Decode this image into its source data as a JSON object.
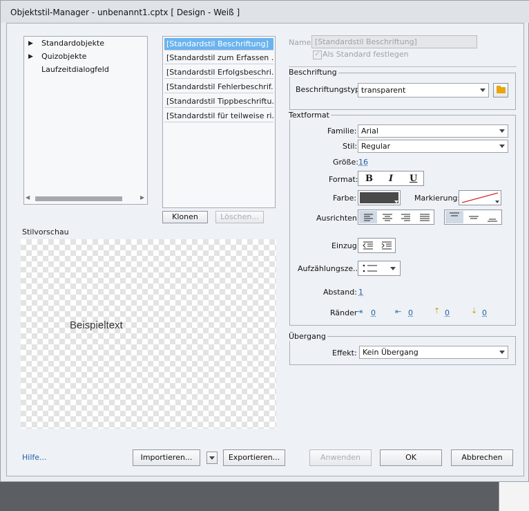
{
  "window": {
    "title": "Objektstil-Manager - unbenannt1.cptx [ Design - Weiß ]"
  },
  "tree": {
    "items": [
      {
        "label": "Standardobjekte",
        "expandable": true
      },
      {
        "label": "Quizobjekte",
        "expandable": true
      },
      {
        "label": "Laufzeitdialogfeld",
        "expandable": false
      }
    ]
  },
  "style_list": {
    "items": [
      "[Standardstil Beschriftung]",
      "[Standardstil zum Erfassen ...",
      "[Standardstil Erfolgsbeschri...",
      "[Standardstil Fehlerbeschrif...",
      "[Standardstil Tippbeschriftu...",
      "[Standardstil für teilweise ri..."
    ],
    "selected_index": 0
  },
  "buttons": {
    "clone": "Klonen",
    "delete": "Löschen...",
    "import": "Importieren...",
    "export": "Exportieren...",
    "apply": "Anwenden",
    "ok": "OK",
    "cancel": "Abbrechen"
  },
  "preview": {
    "label": "Stilvorschau",
    "sample_text": "Beispieltext"
  },
  "help": {
    "label": "Hilfe..."
  },
  "name_field": {
    "label": "Name",
    "value": "[Standardstil Beschriftung]",
    "default_checkbox_label": "Als Standard festlegen"
  },
  "caption_group": {
    "title": "Beschriftung",
    "type_label": "Beschriftungstyp",
    "type_value": "transparent"
  },
  "text_format": {
    "title": "Textformat",
    "family_label": "Familie:",
    "family_value": "Arial",
    "style_label": "Stil:",
    "style_value": "Regular",
    "size_label": "Größe:",
    "size_value": "16",
    "format_label": "Format:",
    "bold": "B",
    "italic": "I",
    "underline": "U",
    "color_label": "Farbe:",
    "color_value": "#4a4a4a",
    "highlight_label": "Markierung:",
    "align_label": "Ausrichten:",
    "indent_label": "Einzug:",
    "bullets_label": "Aufzählungsze...",
    "spacing_label": "Abstand:",
    "spacing_value": "1",
    "margins_label": "Ränder",
    "margin_values": [
      "0",
      "0",
      "0",
      "0"
    ]
  },
  "transition_group": {
    "title": "Übergang",
    "effect_label": "Effekt:",
    "effect_value": "Kein Übergang"
  },
  "colors": {
    "accent": "#6bb4ee",
    "folder": "#e8a50c",
    "link": "#1f5fa8"
  }
}
